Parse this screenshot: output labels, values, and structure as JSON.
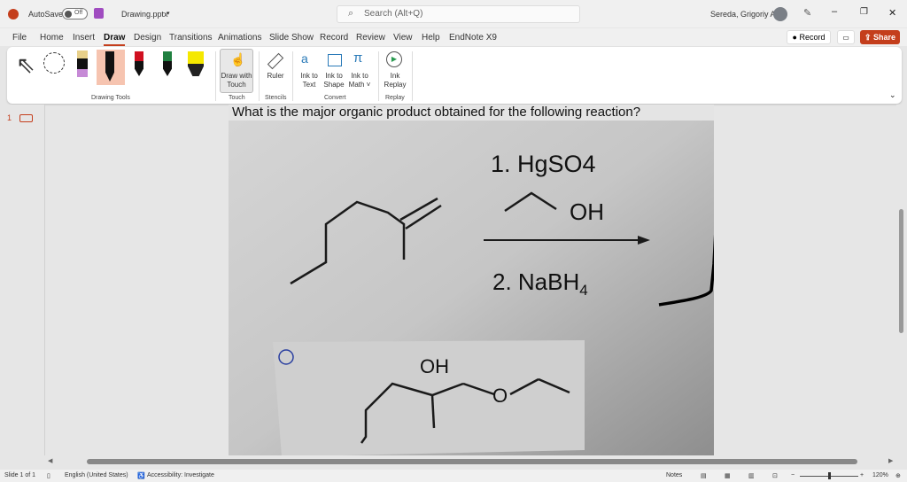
{
  "titlebar": {
    "autosave": "AutoSave",
    "toggle": "Off",
    "filename": "Drawing.pptx",
    "search_placeholder": "Search (Alt+Q)",
    "user": "Sereda, Grigoriy A"
  },
  "tabs": [
    "File",
    "Home",
    "Insert",
    "Draw",
    "Design",
    "Transitions",
    "Animations",
    "Slide Show",
    "Record",
    "Review",
    "View",
    "Help",
    "EndNote X9"
  ],
  "actions": {
    "record": "Record",
    "share": "Share"
  },
  "ribbon": {
    "draw_with_touch": [
      "Draw with",
      "Touch"
    ],
    "ruler": "Ruler",
    "ink_to_text": [
      "Ink to",
      "Text"
    ],
    "ink_to_shape": [
      "Ink to",
      "Shape"
    ],
    "ink_to_math": [
      "Ink to",
      "Math ˅"
    ],
    "ink_replay": [
      "Ink",
      "Replay"
    ],
    "groups": {
      "drawing_tools": "Drawing Tools",
      "touch": "Touch",
      "stencils": "Stencils",
      "convert": "Convert",
      "replay": "Replay"
    }
  },
  "thumbs": {
    "slide_number": "1"
  },
  "slide": {
    "question": "What is the major organic product obtained for the following reaction?",
    "step1": "1. HgSO4",
    "oh1": "OH",
    "step2": "2. NaBH",
    "step2_sub": "4",
    "oh2": "OH",
    "o": "O"
  },
  "status": {
    "slide": "Slide 1 of 1",
    "language": "English (United States)",
    "accessibility": "Accessibility: Investigate",
    "notes": "Notes",
    "zoom": "120%"
  },
  "colors": {
    "accent": "#c43e1c"
  }
}
